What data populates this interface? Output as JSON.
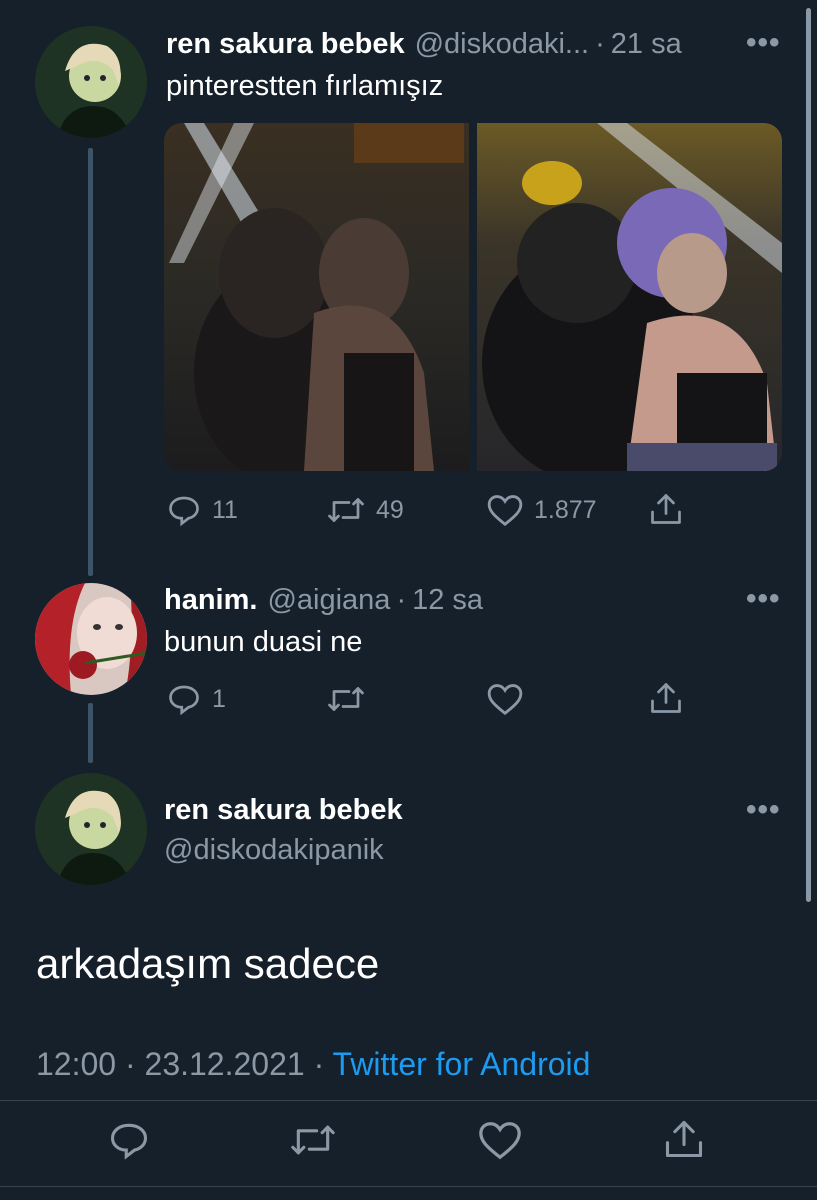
{
  "colors": {
    "background": "#15202b",
    "secondary_text": "#8b98a5",
    "link": "#1d9bf0",
    "thread_line": "#3d5466"
  },
  "tweet1": {
    "name": "ren sakura bebek",
    "handle": "@diskodaki...",
    "dot": "·",
    "time": "21 sa",
    "more": "•••",
    "text": "pinterestten fırlamışız",
    "replies": "11",
    "retweets": "49",
    "likes": "1.877"
  },
  "tweet2": {
    "name": "hanim.",
    "handle": "@aigiana",
    "dot": "·",
    "time": "12 sa",
    "more": "•••",
    "text": "bunun duasi ne",
    "replies": "1"
  },
  "main_tweet": {
    "name": "ren sakura bebek",
    "handle": "@diskodakipanik",
    "more": "•••",
    "text": "arkadaşım sadece",
    "time": "12:00",
    "date": "23.12.2021",
    "dot": "·",
    "source": "Twitter for Android"
  },
  "icons": [
    "reply-icon",
    "retweet-icon",
    "like-icon",
    "share-icon",
    "more-icon"
  ]
}
